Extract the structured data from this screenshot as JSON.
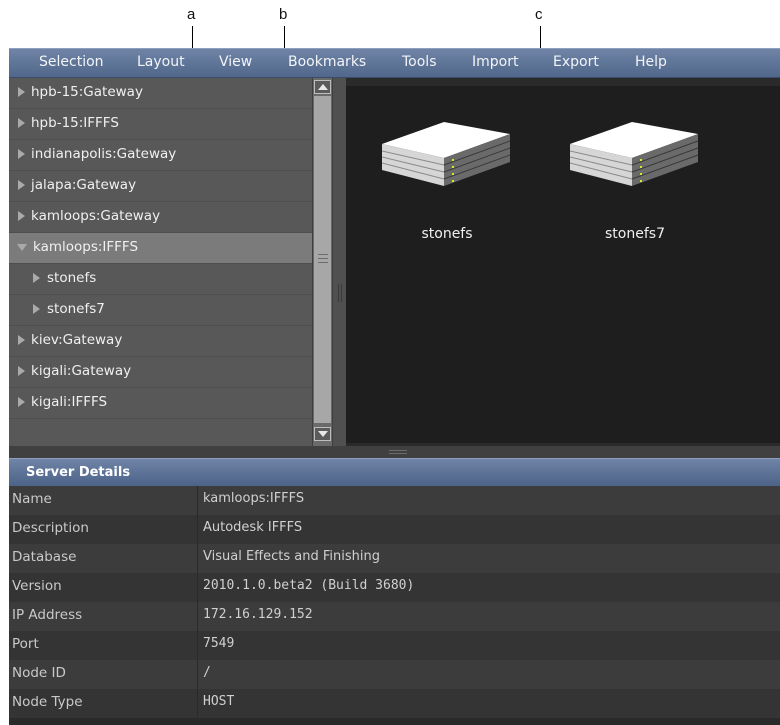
{
  "callouts": [
    "a",
    "b",
    "c"
  ],
  "menu": [
    "Selection",
    "Layout",
    "View",
    "Bookmarks",
    "Tools",
    "Import",
    "Export",
    "Help"
  ],
  "tree": [
    {
      "label": "hpb-15:Gateway"
    },
    {
      "label": "hpb-15:IFFFS"
    },
    {
      "label": "indianapolis:Gateway"
    },
    {
      "label": "jalapa:Gateway"
    },
    {
      "label": "kamloops:Gateway"
    },
    {
      "label": "kamloops:IFFFS",
      "expanded": true,
      "selected": true
    },
    {
      "label": "stonefs",
      "child": true
    },
    {
      "label": "stonefs7",
      "child": true
    },
    {
      "label": "kiev:Gateway"
    },
    {
      "label": "kigali:Gateway"
    },
    {
      "label": "kigali:IFFFS"
    }
  ],
  "viewer": {
    "servers": [
      "stonefs",
      "stonefs7"
    ]
  },
  "details": {
    "title": "Server Details",
    "rows": [
      {
        "name": "Name",
        "value": "kamloops:IFFFS"
      },
      {
        "name": "Description",
        "value": "Autodesk IFFFS"
      },
      {
        "name": "Database",
        "value": "Visual Effects and Finishing"
      },
      {
        "name": "Version",
        "value": "2010.1.0.beta2 (Build 3680)"
      },
      {
        "name": "IP Address",
        "value": "172.16.129.152"
      },
      {
        "name": "Port",
        "value": "7549"
      },
      {
        "name": "Node ID",
        "value": "/"
      },
      {
        "name": "Node Type",
        "value": "HOST"
      }
    ]
  },
  "colors": {
    "menubar": "#5c7295",
    "tree_bg": "#585858",
    "viewer_bg": "#1e1e1e",
    "led": "#d8e82a"
  }
}
